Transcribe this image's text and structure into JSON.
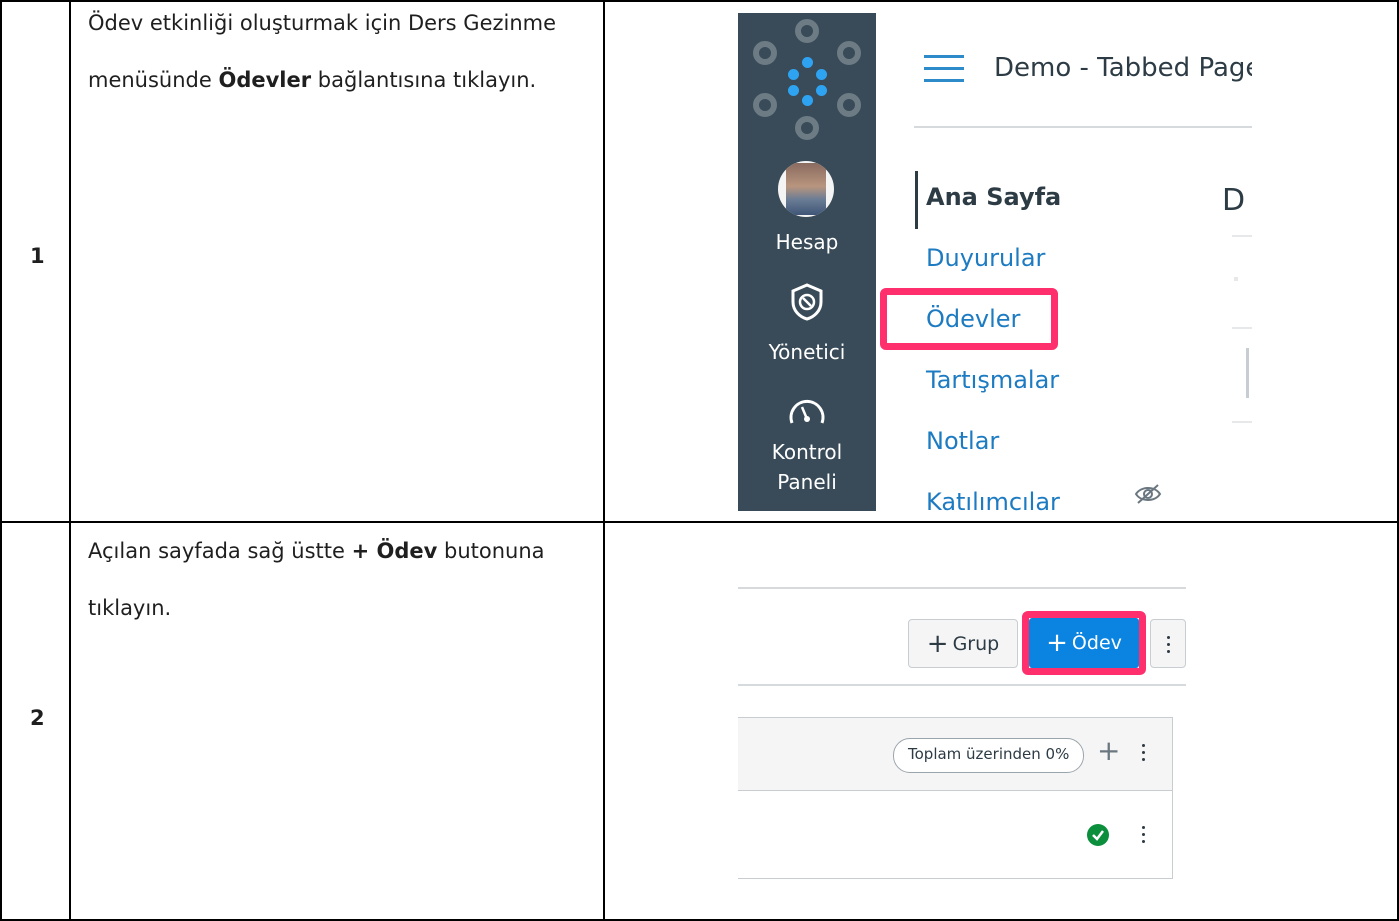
{
  "steps": [
    {
      "number": "1",
      "text_pre": "Ödev etkinliği oluşturmak için Ders Gezinme menüsünde ",
      "text_bold": "Ödevler",
      "text_post": " bağlantısına tıklayın."
    },
    {
      "number": "2",
      "text_pre": "Açılan sayfada sağ üstte ",
      "text_bold": "+ Ödev",
      "text_post": " butonuna tıklayın."
    }
  ],
  "screenshot1": {
    "global_nav": {
      "account_label": "Hesap",
      "admin_label": "Yönetici",
      "dashboard_label_line1": "Kontrol",
      "dashboard_label_line2": "Paneli"
    },
    "breadcrumb": "Demo - Tabbed Page",
    "right_cut_letter": "D",
    "course_nav": {
      "items": [
        {
          "label": "Ana Sayfa"
        },
        {
          "label": "Duyurular"
        },
        {
          "label": "Ödevler"
        },
        {
          "label": "Tartışmalar"
        },
        {
          "label": "Notlar"
        },
        {
          "label": "Katılımcılar"
        }
      ]
    },
    "colors": {
      "nav_bg": "#394b58",
      "link": "#1d7bc2",
      "highlight": "#ff2f6e"
    }
  },
  "screenshot2": {
    "group_button": "Grup",
    "assignment_button": "Ödev",
    "total_pill": "Toplam üzerinden 0%",
    "colors": {
      "primary": "#0a84e0",
      "highlight": "#ff2f6e",
      "success": "#0b8f3d"
    }
  }
}
